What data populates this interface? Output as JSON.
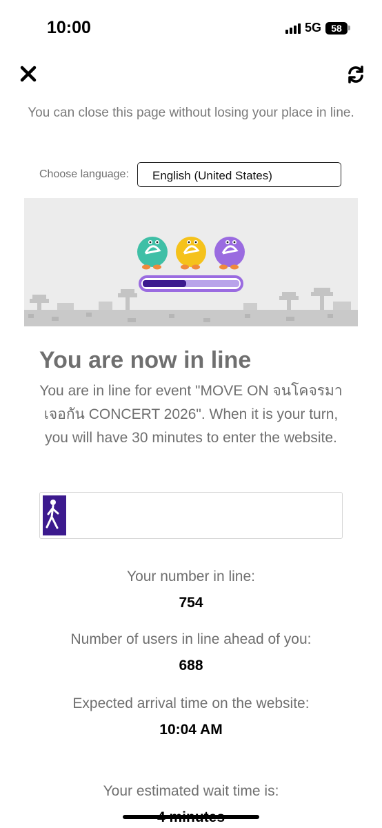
{
  "status_bar": {
    "time": "10:00",
    "network": "5G",
    "battery": "58"
  },
  "toolbar": {
    "close_icon": "close-icon",
    "refresh_icon": "refresh-icon"
  },
  "notice": "You can close this page without losing your place in line.",
  "language": {
    "label": "Choose language:",
    "selected": "English (United States)"
  },
  "banner": {
    "progress_fraction": 0.45,
    "character_colors": [
      "#3fbfa6",
      "#f5c21b",
      "#9a6be0"
    ],
    "bar_color": "#3c1a8e"
  },
  "queue": {
    "heading": "You are now in line",
    "description": "You are in line for event \"MOVE ON จนโคจรมาเจอกัน CONCERT 2026\". When it is your turn, you will have 30 minutes to enter the website.",
    "progress_fraction": 0.08,
    "progress_color": "#3c1a8e",
    "number_label": "Your number in line:",
    "number_value": "754",
    "ahead_label": "Number of users in line ahead of you:",
    "ahead_value": "688",
    "arrival_label": "Expected arrival time on the website:",
    "arrival_value": "10:04 AM",
    "wait_label": "Your estimated wait time is:",
    "wait_value": "4 minutes"
  }
}
